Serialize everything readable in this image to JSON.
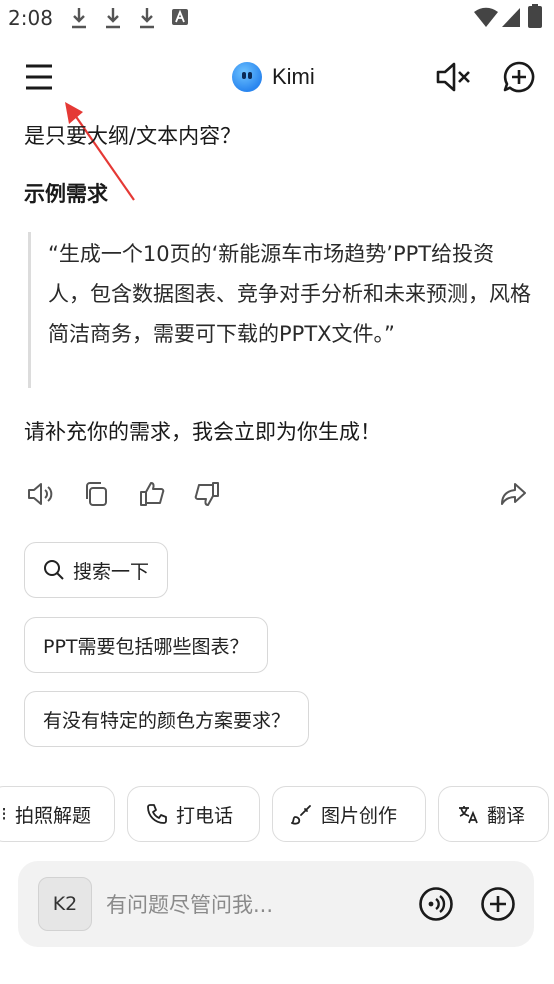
{
  "status": {
    "time": "2:08"
  },
  "header": {
    "title": "Kimi"
  },
  "message": {
    "intro_line": "是只要大纲/文本内容？",
    "example_heading": "示例需求",
    "example_quote": "“生成一个10页的‘新能源车市场趋势’PPT给投资人，包含数据图表、竞争对手分析和未来预测，风格简洁商务，需要可下载的PPTX文件。”",
    "closing": "请补充你的需求，我会立即为你生成！"
  },
  "suggestions": {
    "search": "搜索一下",
    "q1": "PPT需要包括哪些图表？",
    "q2": "有没有特定的颜色方案要求？"
  },
  "tools": {
    "photo_solve": "拍照解题",
    "call": "打电话",
    "image_create": "图片创作",
    "translate": "翻译"
  },
  "input": {
    "model_badge": "K2",
    "placeholder": "有问题尽管问我..."
  },
  "colors": {
    "accent": "#2a86ef",
    "annotation_arrow": "#e53935"
  }
}
